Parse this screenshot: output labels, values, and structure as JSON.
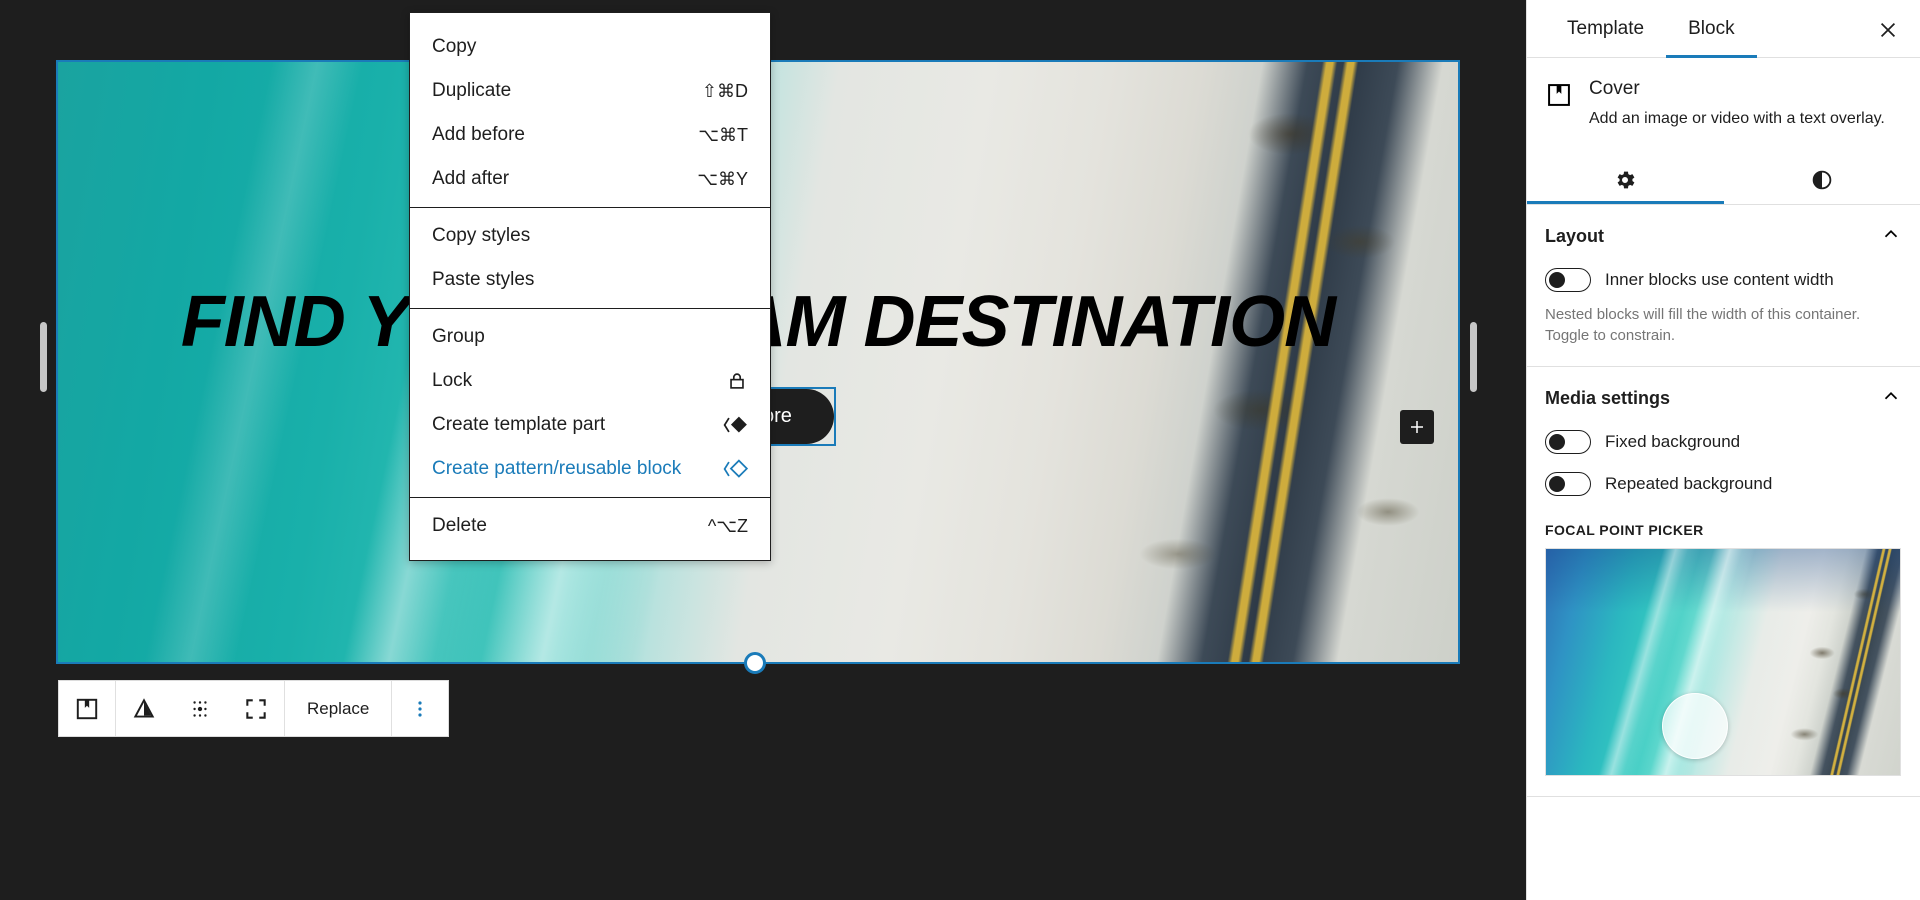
{
  "context_menu": {
    "groups": [
      {
        "items": [
          {
            "label": "Copy",
            "shortcut": "",
            "icon": ""
          },
          {
            "label": "Duplicate",
            "shortcut": "⇧⌘D",
            "icon": ""
          },
          {
            "label": "Add before",
            "shortcut": "⌥⌘T",
            "icon": ""
          },
          {
            "label": "Add after",
            "shortcut": "⌥⌘Y",
            "icon": ""
          }
        ]
      },
      {
        "items": [
          {
            "label": "Copy styles",
            "shortcut": "",
            "icon": ""
          },
          {
            "label": "Paste styles",
            "shortcut": "",
            "icon": ""
          }
        ]
      },
      {
        "items": [
          {
            "label": "Group",
            "shortcut": "",
            "icon": ""
          },
          {
            "label": "Lock",
            "shortcut": "",
            "icon": "lock-icon"
          },
          {
            "label": "Create template part",
            "shortcut": "",
            "icon": "template-part-icon"
          },
          {
            "label": "Create pattern/reusable block",
            "shortcut": "",
            "icon": "reusable-block-icon",
            "accent": true
          }
        ]
      },
      {
        "items": [
          {
            "label": "Delete",
            "shortcut": "^⌥Z",
            "icon": ""
          }
        ]
      }
    ]
  },
  "canvas": {
    "cover": {
      "heading": "FIND YOUR DREAM DESTINATION",
      "button_label": "Explore",
      "add_block_icon": "plus-icon"
    },
    "toolbar": {
      "block_type_icon": "cover-block-icon",
      "align_icon": "align-triangle-icon",
      "drag_icon": "drag-handle-icon",
      "fullwidth_icon": "full-width-icon",
      "replace_label": "Replace",
      "more_icon": "more-options-vertical-icon"
    }
  },
  "sidebar": {
    "tabs": [
      {
        "label": "Template",
        "active": false
      },
      {
        "label": "Block",
        "active": true
      }
    ],
    "close_icon": "close-icon",
    "block": {
      "icon": "cover-block-icon",
      "title": "Cover",
      "description": "Add an image or video with a text overlay."
    },
    "icon_tabs": [
      {
        "icon": "gear-icon",
        "active": true
      },
      {
        "icon": "contrast-icon",
        "active": false
      }
    ],
    "sections": [
      {
        "title": "Layout",
        "collapse_icon": "chevron-up-icon",
        "rows": [
          {
            "label": "Inner blocks use content width",
            "toggle": "off"
          }
        ],
        "help": "Nested blocks will fill the width of this container. Toggle to constrain."
      },
      {
        "title": "Media settings",
        "collapse_icon": "chevron-up-icon",
        "rows": [
          {
            "label": "Fixed background",
            "toggle": "off"
          },
          {
            "label": "Repeated background",
            "toggle": "off"
          }
        ],
        "focal_point_label": "Focal point picker"
      }
    ]
  },
  "colors": {
    "accent": "#1a7bb9",
    "canvas_bg": "#1e1e1e",
    "panel_bg": "#ffffff",
    "text": "#1e1e1e",
    "muted_text": "#757575"
  }
}
